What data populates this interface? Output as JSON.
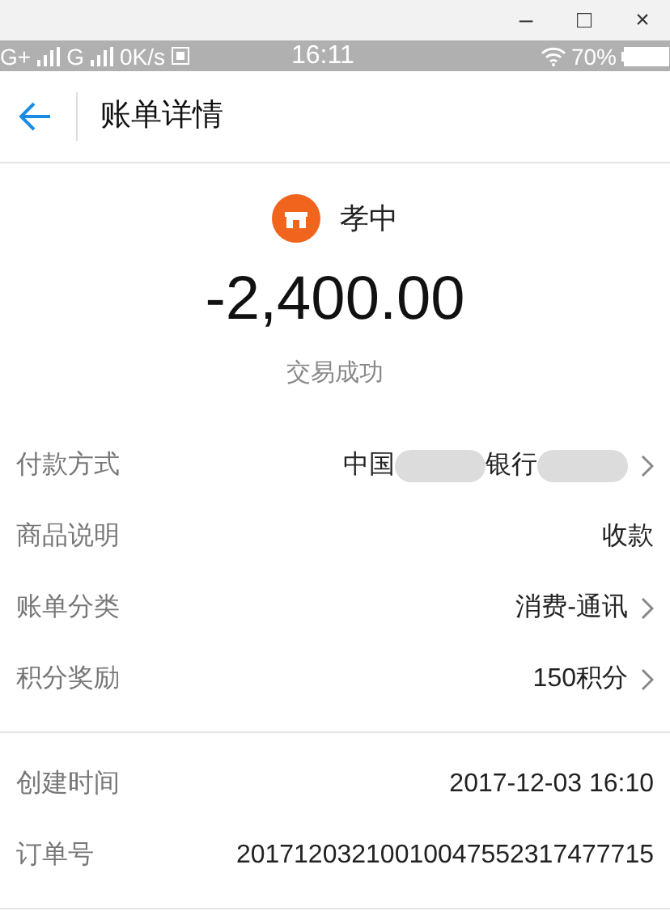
{
  "window_controls": [
    "–",
    "□",
    "×"
  ],
  "status_bar": {
    "network_1": "G+",
    "network_2": "G",
    "speed": "0K/s",
    "time": "16:11",
    "battery": "70%"
  },
  "header": {
    "title": "账单详情"
  },
  "merchant": {
    "name": "孝中"
  },
  "amount": "-2,400.00",
  "status": "交易成功",
  "sections": [
    [
      {
        "label": "付款方式",
        "value": [
          {
            "kind": "text",
            "text": "中国"
          },
          {
            "kind": "redacted"
          },
          {
            "kind": "text",
            "text": "银行"
          },
          {
            "kind": "redacted"
          }
        ],
        "chevron": true
      },
      {
        "label": "商品说明",
        "value": [
          {
            "kind": "text",
            "text": "收款"
          }
        ],
        "chevron": false
      },
      {
        "label": "账单分类",
        "value": [
          {
            "kind": "text",
            "text": "消费-通讯"
          }
        ],
        "chevron": true
      },
      {
        "label": "积分奖励",
        "value": [
          {
            "kind": "text",
            "text": "150积分"
          }
        ],
        "chevron": true
      }
    ],
    [
      {
        "label": "创建时间",
        "value": [
          {
            "kind": "text",
            "text": "2017-12-03 16:10"
          }
        ],
        "chevron": false
      },
      {
        "label": "订单号",
        "value": [
          {
            "kind": "text",
            "text": "20171203210010047552317477715"
          }
        ],
        "chevron": false
      }
    ]
  ]
}
